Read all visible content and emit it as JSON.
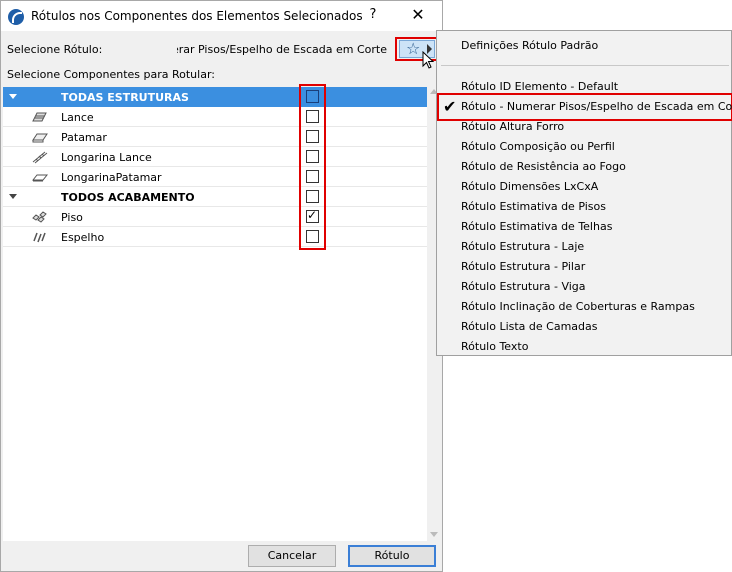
{
  "dialog": {
    "title": "Rótulos nos Componentes dos Elementos Selecionados",
    "help_label": "?",
    "close_label": "✕",
    "select_label": "Selecione Rótulo:",
    "select_value": "Rótulo - Numerar Pisos/Espelho de Escada em Corte",
    "favorite_icon": "☆",
    "components_label": "Selecione Componentes para Rotular:",
    "rows": [
      {
        "label": "TODAS ESTRUTURAS",
        "bold": true,
        "group": true,
        "checked": false,
        "selected": true
      },
      {
        "label": "Lance",
        "icon": "stair-flight-icon",
        "checked": false
      },
      {
        "label": "Patamar",
        "icon": "landing-icon",
        "checked": false
      },
      {
        "label": "Longarina Lance",
        "icon": "stringer-flight-icon",
        "checked": false
      },
      {
        "label": "LongarinaPatamar",
        "icon": "stringer-landing-icon",
        "checked": false
      },
      {
        "label": "TODOS ACABAMENTO",
        "bold": true,
        "group": true,
        "checked": false
      },
      {
        "label": "Piso",
        "icon": "tread-icon",
        "checked": true
      },
      {
        "label": "Espelho",
        "icon": "riser-icon",
        "checked": false
      }
    ],
    "cancel_label": "Cancelar",
    "ok_label": "Rótulo",
    "check_mark": "✓"
  },
  "menu": {
    "default_label": "Definições Rótulo Padrão",
    "checked_item": "Rótulo - Numerar Pisos/Espelho de Escada em Corte",
    "check_icon": "✔",
    "items": [
      "Rótulo ID Elemento - Default",
      "Rótulo Altura Forro",
      "Rótulo Composição ou Perfil",
      "Rótulo de Resistência ao Fogo",
      "Rótulo Dimensões LxCxA",
      "Rótulo Estimativa de Pisos",
      "Rótulo Estimativa de Telhas",
      "Rótulo Estrutura - Laje",
      "Rótulo Estrutura - Pilar",
      "Rótulo Estrutura - Viga",
      "Rótulo Inclinação de Coberturas e Rampas",
      "Rótulo Lista de Camadas",
      "Rótulo Texto"
    ]
  },
  "colors": {
    "selection": "#3b8fe0",
    "highlight": "#e00000"
  }
}
